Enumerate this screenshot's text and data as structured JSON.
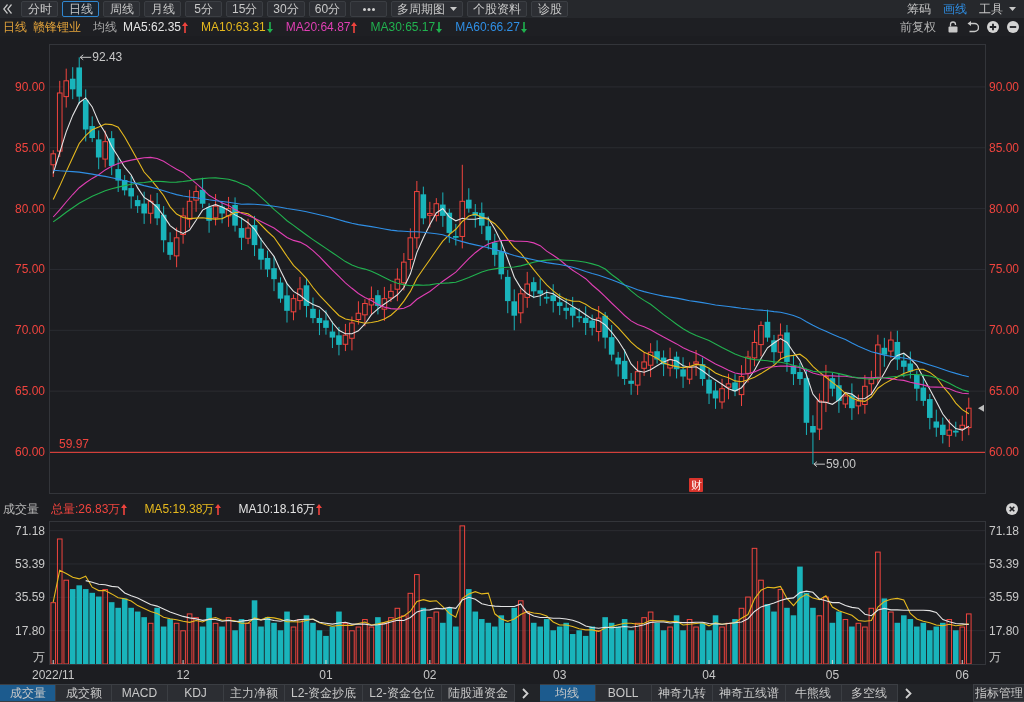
{
  "toolbar": {
    "tabs": [
      {
        "label": "分时",
        "selected": false
      },
      {
        "label": "日线",
        "selected": true
      },
      {
        "label": "周线",
        "selected": false
      },
      {
        "label": "月线",
        "selected": false
      },
      {
        "label": "5分",
        "selected": false
      },
      {
        "label": "15分",
        "selected": false
      },
      {
        "label": "30分",
        "selected": false
      },
      {
        "label": "60分",
        "selected": false
      }
    ],
    "buttons": [
      {
        "kind": "more"
      },
      {
        "kind": "dropdown",
        "label": "多周期图"
      },
      {
        "kind": "plain",
        "label": "个股资料"
      },
      {
        "kind": "plain",
        "label": "诊股"
      }
    ],
    "tools": [
      {
        "kind": "plain",
        "label": "筹码",
        "active": false
      },
      {
        "kind": "plain",
        "label": "画线",
        "active": true
      },
      {
        "kind": "dropdown",
        "label": "工具",
        "active": false
      }
    ]
  },
  "info_bar": {
    "period": "日线",
    "stock_name": "赣锋锂业",
    "indicator": "均线",
    "averages": [
      {
        "label": "MA5:62.35",
        "color": "#e4e4e4",
        "rising": true
      },
      {
        "label": "MA10:63.31",
        "color": "#e6b91e",
        "rising": false
      },
      {
        "label": "MA20:64.87",
        "color": "#e03fb4",
        "rising": true
      },
      {
        "label": "MA30:65.17",
        "color": "#21b24f",
        "rising": false
      },
      {
        "label": "MA60:66.27",
        "color": "#2f8fe5",
        "rising": false
      }
    ],
    "adjustment": "前复权"
  },
  "price_chart": {
    "left_axis": [
      "90.00",
      "85.00",
      "80.00",
      "75.00",
      "70.00",
      "65.00",
      "60.00"
    ],
    "right_axis": [
      "90.00",
      "85.00",
      "80.00",
      "75.00",
      "70.00",
      "65.00",
      "60.00"
    ],
    "high_label": "92.43",
    "low_label": "59.00",
    "price_line_label": "59.97",
    "badge": "财"
  },
  "volume_panel": {
    "title": "成交量",
    "stats": [
      {
        "label": "总量:26.83万",
        "color": "#f0443e",
        "rising": true
      },
      {
        "label": "MA5:19.38万",
        "color": "#e6b91e",
        "rising": true
      },
      {
        "label": "MA10:18.16万",
        "color": "#e4e4e4",
        "rising": true
      }
    ],
    "right_axis": [
      "71.18",
      "53.39",
      "35.59",
      "17.80",
      "万"
    ],
    "chart_data": {
      "type": "bar",
      "stacked": true,
      "grid": true,
      "ylabel": "万",
      "ylim": [
        0,
        75.8
      ],
      "yticks": [
        {
          "value": 71.18,
          "label": "71.18"
        },
        {
          "value": 53.39,
          "label": "53.39"
        },
        {
          "value": 35.59,
          "label": "35.59"
        },
        {
          "value": 17.8,
          "label": "17.80"
        }
      ],
      "series": [
        {
          "color": "#f0443e",
          "values": [
            33,
            67,
            45,
            null,
            null,
            null,
            null,
            null,
            40,
            null,
            null,
            null,
            null,
            null,
            null,
            22,
            null,
            null,
            null,
            22,
            18,
            27,
            25,
            null,
            null,
            22,
            null,
            25,
            null,
            null,
            22,
            null,
            null,
            null,
            null,
            null,
            null,
            20,
            24,
            null,
            null,
            null,
            null,
            null,
            null,
            22,
            18,
            20,
            24,
            20,
            null,
            22,
            25,
            30,
            26,
            38,
            48,
            null,
            25,
            28,
            null,
            null,
            null,
            74,
            null,
            null,
            null,
            null,
            null,
            null,
            null,
            null,
            34,
            28,
            null,
            null,
            null,
            null,
            null,
            null,
            null,
            null,
            null,
            null,
            18,
            null,
            null,
            null,
            null,
            null,
            22,
            25,
            28,
            null,
            null,
            20,
            null,
            null,
            24,
            20,
            null,
            null,
            null,
            20,
            22,
            null,
            30,
            36,
            62,
            45,
            null,
            null,
            40,
            null,
            null,
            null,
            null,
            null,
            26,
            36,
            null,
            null,
            24,
            null,
            22,
            20,
            30,
            60,
            null,
            28,
            null,
            null,
            null,
            null,
            null,
            null,
            null,
            null,
            24,
            null,
            20,
            27,
            null,
            null
          ]
        },
        {
          "color": "#19b4bb",
          "values": [
            null,
            null,
            null,
            40,
            42,
            40,
            38,
            36,
            null,
            33,
            30,
            35,
            30,
            28,
            25,
            null,
            30,
            20,
            24,
            null,
            null,
            null,
            null,
            20,
            30,
            null,
            20,
            null,
            18,
            24,
            null,
            34,
            20,
            25,
            22,
            18,
            28,
            null,
            null,
            26,
            22,
            18,
            15,
            20,
            28,
            null,
            null,
            null,
            null,
            null,
            25,
            null,
            null,
            null,
            null,
            null,
            null,
            30,
            null,
            null,
            22,
            30,
            20,
            null,
            40,
            28,
            24,
            22,
            20,
            26,
            22,
            30,
            null,
            null,
            22,
            20,
            24,
            18,
            20,
            22,
            16,
            18,
            15,
            20,
            null,
            25,
            22,
            20,
            24,
            18,
            null,
            null,
            null,
            22,
            18,
            null,
            26,
            18,
            null,
            null,
            22,
            18,
            26,
            null,
            null,
            24,
            null,
            null,
            null,
            null,
            32,
            28,
            null,
            30,
            26,
            52,
            38,
            30,
            null,
            null,
            22,
            28,
            null,
            20,
            null,
            null,
            null,
            null,
            35,
            null,
            22,
            26,
            24,
            20,
            22,
            18,
            20,
            22,
            null,
            18,
            null,
            null,
            null,
            null
          ]
        }
      ]
    },
    "average_lines": {
      "chart_data": {
        "type": "line",
        "ylim": [
          0,
          75.8
        ],
        "series": [
          {
            "color": "#e6b91e",
            "values": [
              33,
              50,
              48.3,
              46.3,
              45.4,
              46.8,
              41,
              39.2,
              39.2,
              37.4,
              35.4,
              34.8,
              33.6,
              31.2,
              29.6,
              28,
              27,
              25,
              24.2,
              23.6,
              22.8,
              22.2,
              23.2,
              22.4,
              24,
              24.8,
              23.4,
              23.4,
              23,
              21.8,
              21.8,
              24.6,
              23.6,
              25,
              24.6,
              23.8,
              22.6,
              22.6,
              22.4,
              23.2,
              24,
              22,
              21,
              20.2,
              20.6,
              20.6,
              20.6,
              21.6,
              22.4,
              20.8,
              21.4,
              22.2,
              23.2,
              24.4,
              25.6,
              28.2,
              33.4,
              34.4,
              33.4,
              33.8,
              30.6,
              27,
              25,
              35,
              37.4,
              38.6,
              37.4,
              37.8,
              26.8,
              24,
              22.8,
              24,
              26.4,
              28,
              27.2,
              26.8,
              25.6,
              22.4,
              20.8,
              20.8,
              20,
              18.8,
              18.2,
              18.2,
              17.4,
              19.2,
              20,
              21,
              21.8,
              21.8,
              21.2,
              21.8,
              23.4,
              23,
              23,
              22.6,
              22.8,
              20.8,
              21.2,
              21.6,
              22,
              20.4,
              22,
              21.2,
              21.6,
              22,
              24.4,
              26.4,
              34.8,
              39.4,
              41,
              40.6,
              41.4,
              35,
              31.2,
              35.2,
              37.2,
              35.2,
              34.4,
              36.4,
              30.4,
              28.4,
              27.2,
              26,
              23.2,
              22.8,
              23.2,
              30.4,
              33.4,
              34.6,
              35,
              34.2,
              27,
              24,
              22.8,
              22,
              20.8,
              20.4,
              21.2,
              20.4,
              20.8,
              21.4,
              null,
              null
            ]
          },
          {
            "color": "#e4e4e4",
            "values": [
              null,
              null,
              null,
              null,
              null,
              44.5,
              43.6,
              42.6,
              42.3,
              41.4,
              41.1,
              37.9,
              36.4,
              35.2,
              33.5,
              31.7,
              30.9,
              29.3,
              27.7,
              26.6,
              25.4,
              24.6,
              24.1,
              23.3,
              23.8,
              23.8,
              22.8,
              23.3,
              22.7,
              22.9,
              23.3,
              24,
              23.5,
              24,
              23.2,
              22.8,
              23.6,
              23.1,
              23.7,
              23.9,
              23.9,
              22.3,
              21.8,
              21.3,
              21.9,
              22.3,
              21.3,
              21.3,
              21.3,
              20.7,
              21,
              21.4,
              22.4,
              23.4,
              23.2,
              24.8,
              27.8,
              28.8,
              28.9,
              29.7,
              29.4,
              30.2,
              29.7,
              34.2,
              35.6,
              34.6,
              32.2,
              31.4,
              30.9,
              30.7,
              30.7,
              30.7,
              32.1,
              27.4,
              25.6,
              24.8,
              24.8,
              24.4,
              24.4,
              24,
              23.4,
              22.2,
              20.3,
              19.5,
              19.1,
              19.6,
              19.4,
              19.6,
              20,
              19.6,
              20.2,
              20.9,
              22.2,
              22.4,
              22.4,
              21.9,
              22.3,
              22.1,
              22.1,
              22.3,
              22.3,
              21.6,
              21.4,
              21.2,
              21.6,
              22,
              22.4,
              24.2,
              28,
              30.5,
              31.5,
              32.5,
              33.9,
              34.9,
              35.3,
              38.1,
              38.9,
              38.3,
              34.7,
              33.8,
              32.8,
              32.8,
              31.2,
              30.2,
              29.8,
              26.6,
              25.8,
              28.8,
              29.7,
              28.9,
              28.9,
              28.7,
              28.7,
              28.7,
              28.7,
              28.5,
              27.5,
              23.7,
              22.6,
              21.6,
              21.4,
              21.1,
              null,
              null
            ]
          }
        ]
      }
    }
  },
  "date_axis": [
    "2022/11",
    "12",
    "01",
    "02",
    "03",
    "04",
    "05",
    "06"
  ],
  "bottom_bar": {
    "indicator_tabs": [
      {
        "label": "成交量",
        "selected": true
      },
      {
        "label": "成交额",
        "selected": false
      },
      {
        "label": "MACD",
        "selected": false
      },
      {
        "label": "KDJ",
        "selected": false
      },
      {
        "label": "主力净额",
        "selected": false
      },
      {
        "label": "L2-资金抄底",
        "selected": false
      },
      {
        "label": "L2-资金仓位",
        "selected": false
      },
      {
        "label": "陆股通资金",
        "selected": false
      }
    ],
    "overlay_tabs": [
      {
        "label": "均线",
        "selected": true
      },
      {
        "label": "BOLL",
        "selected": false
      },
      {
        "label": "神奇九转",
        "selected": false
      },
      {
        "label": "神奇五线谱",
        "selected": false
      },
      {
        "label": "牛熊线",
        "selected": false
      },
      {
        "label": "多空线",
        "selected": false
      }
    ],
    "manage_button": "指标管理"
  }
}
